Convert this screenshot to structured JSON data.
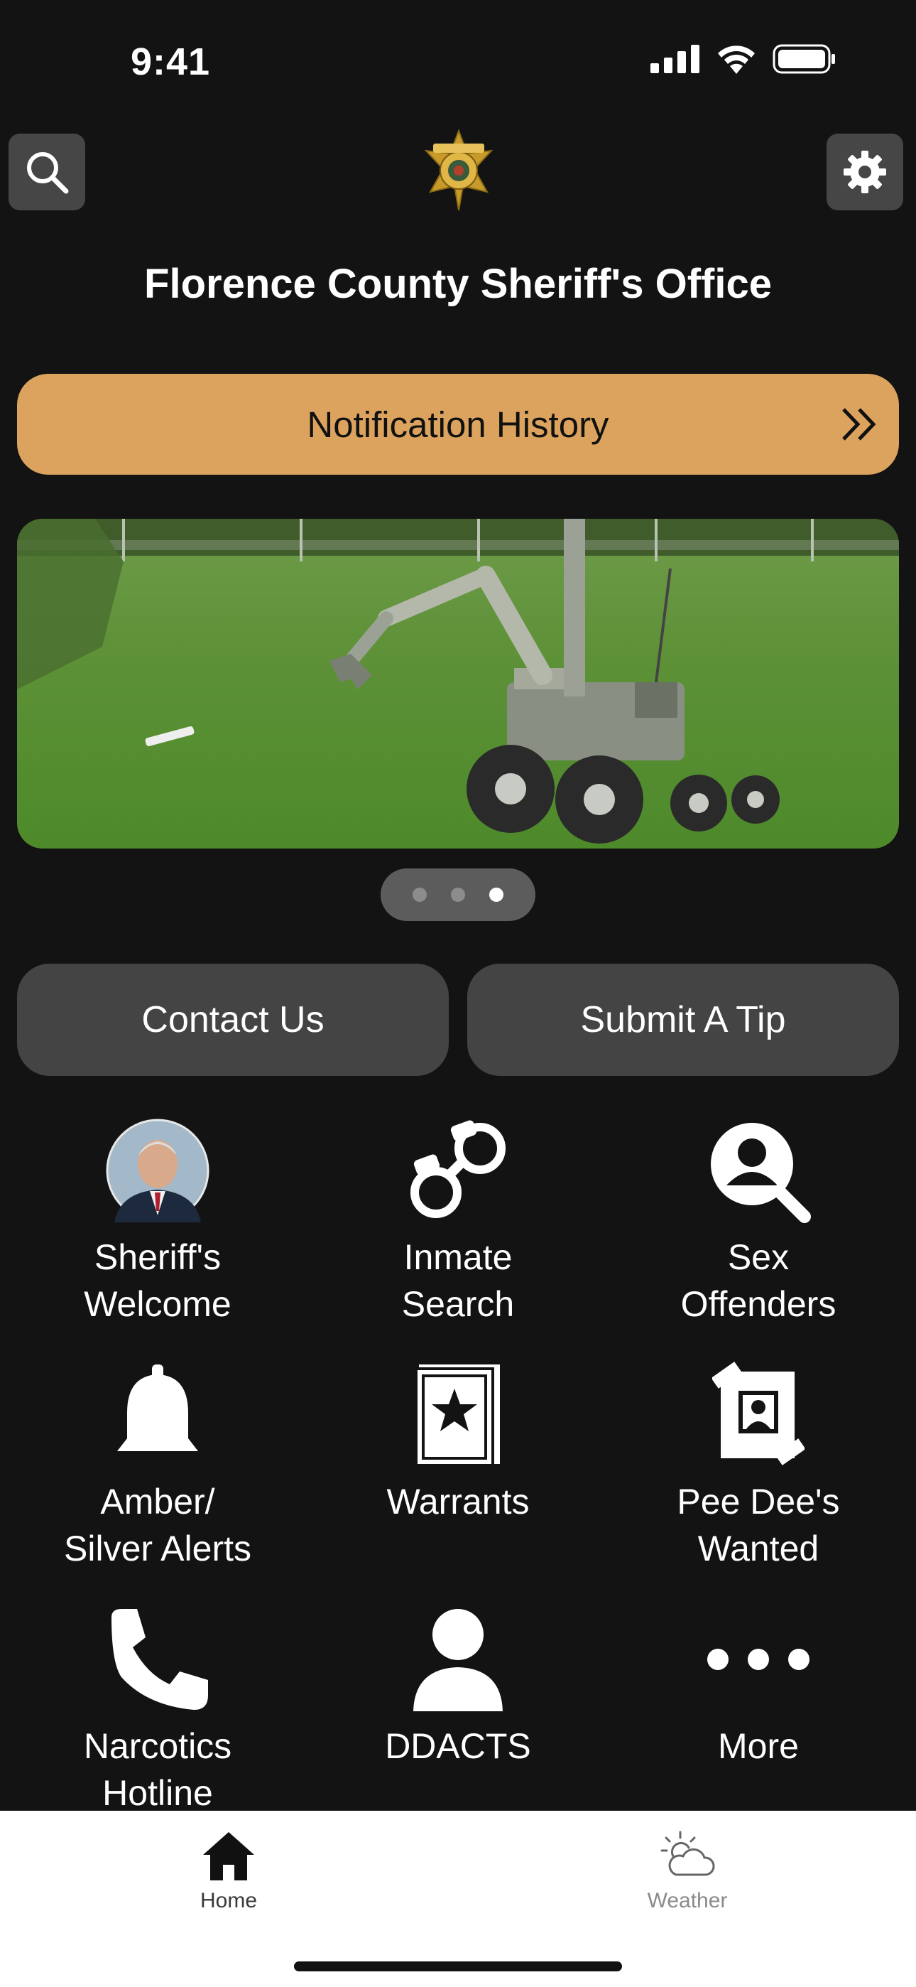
{
  "status_bar": {
    "time": "9:41"
  },
  "header": {
    "title": "Florence County Sheriff's Office",
    "search_icon": "search-icon",
    "settings_icon": "gear-icon",
    "logo": "sheriff-star-badge"
  },
  "notification": {
    "label": "Notification History",
    "icon": "double-chevron-right-icon"
  },
  "carousel": {
    "page_count": 3,
    "active_index": 2
  },
  "actions": {
    "contact": "Contact Us",
    "tip": "Submit A Tip"
  },
  "grid": {
    "items": [
      {
        "line1": "Sheriff's",
        "line2": "Welcome",
        "icon": "sheriff-portrait"
      },
      {
        "line1": "Inmate",
        "line2": "Search",
        "icon": "handcuffs-icon"
      },
      {
        "line1": "Sex",
        "line2": "Offenders",
        "icon": "person-search-icon"
      },
      {
        "line1": "Amber/",
        "line2": "Silver Alerts",
        "icon": "bell-icon"
      },
      {
        "line1": "Warrants",
        "line2": "",
        "icon": "warrant-star-icon"
      },
      {
        "line1": "Pee Dee's",
        "line2": "Wanted",
        "icon": "wanted-poster-icon"
      },
      {
        "line1": "Narcotics",
        "line2": "Hotline",
        "icon": "phone-icon"
      },
      {
        "line1": "DDACTS",
        "line2": "",
        "icon": "person-icon"
      },
      {
        "line1": "More",
        "line2": "",
        "icon": "more-dots-icon"
      }
    ]
  },
  "tabbar": {
    "home": "Home",
    "weather": "Weather"
  },
  "colors": {
    "accent": "#dca35e",
    "background": "#131313",
    "button": "#444444"
  }
}
